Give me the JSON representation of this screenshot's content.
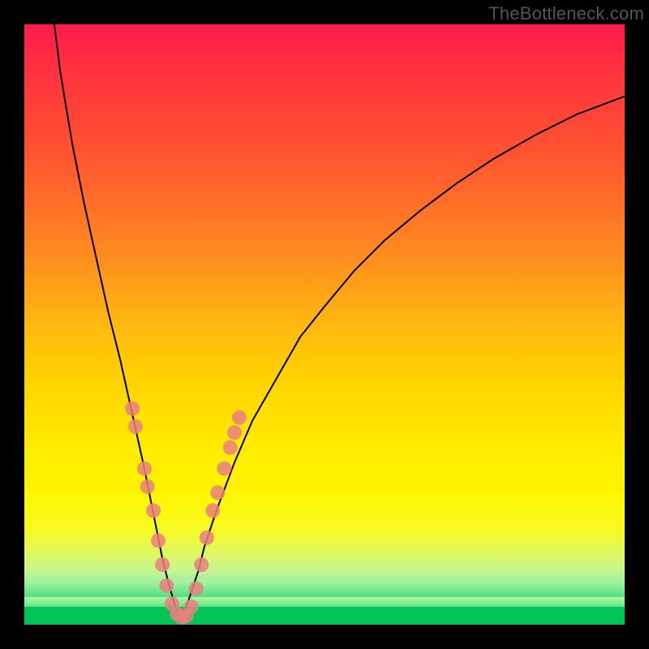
{
  "watermark": "TheBottleneck.com",
  "chart_data": {
    "type": "line",
    "title": "",
    "xlabel": "",
    "ylabel": "",
    "xlim": [
      0,
      100
    ],
    "ylim": [
      0,
      100
    ],
    "series": [
      {
        "name": "left-curve",
        "x": [
          5,
          6,
          8,
          10,
          12,
          14,
          16,
          18,
          20,
          21,
          22,
          23,
          24,
          25,
          26
        ],
        "y": [
          100,
          92,
          80,
          70,
          61,
          52,
          44,
          35,
          26,
          21,
          16,
          11,
          7,
          3.5,
          1
        ]
      },
      {
        "name": "right-curve",
        "x": [
          26,
          27,
          28,
          29,
          30,
          32,
          35,
          38,
          42,
          46,
          50,
          55,
          60,
          66,
          72,
          78,
          85,
          92,
          100
        ],
        "y": [
          1,
          3,
          6,
          9,
          13,
          19,
          27,
          34,
          41,
          48,
          53,
          59,
          64,
          69,
          73.5,
          77.5,
          81.5,
          85,
          88
        ]
      }
    ],
    "dots": [
      {
        "x": 18.0,
        "y": 36
      },
      {
        "x": 18.5,
        "y": 33
      },
      {
        "x": 20.0,
        "y": 26
      },
      {
        "x": 20.5,
        "y": 23
      },
      {
        "x": 21.5,
        "y": 19
      },
      {
        "x": 22.3,
        "y": 14
      },
      {
        "x": 23.0,
        "y": 10
      },
      {
        "x": 23.7,
        "y": 6.5
      },
      {
        "x": 24.6,
        "y": 3.5
      },
      {
        "x": 25.4,
        "y": 1.8
      },
      {
        "x": 26.2,
        "y": 1.2
      },
      {
        "x": 27.0,
        "y": 1.5
      },
      {
        "x": 27.8,
        "y": 3.0
      },
      {
        "x": 28.6,
        "y": 6.0
      },
      {
        "x": 29.5,
        "y": 10
      },
      {
        "x": 30.4,
        "y": 14.5
      },
      {
        "x": 31.4,
        "y": 19
      },
      {
        "x": 32.2,
        "y": 22
      },
      {
        "x": 33.3,
        "y": 26
      },
      {
        "x": 34.3,
        "y": 29.5
      },
      {
        "x": 35.0,
        "y": 32
      },
      {
        "x": 35.8,
        "y": 34.5
      }
    ],
    "minimum_x": 26
  }
}
